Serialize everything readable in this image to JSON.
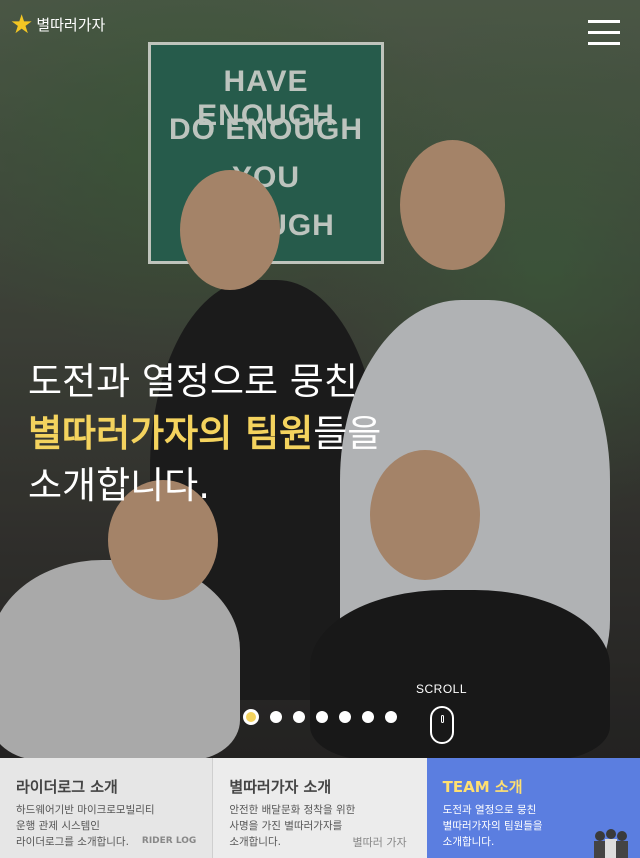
{
  "header": {
    "logo_text": "별따러가자",
    "menu_icon": "hamburger-icon"
  },
  "hero": {
    "sign_lines": [
      "HAVE ENOUGH",
      "DO ENOUGH",
      "YOU",
      "ENOUGH"
    ],
    "headline": {
      "line1": "도전과 열정으로 뭉친",
      "line2_highlight": "별따러가자의 팀원",
      "line2_rest": "들을",
      "line3": "소개합니다."
    },
    "scroll_label": "SCROLL",
    "slider": {
      "count": 7,
      "active_index": 0
    }
  },
  "tabs": [
    {
      "title": "라이더로그 소개",
      "desc": "하드웨어기반 마이크로모빌리티\n운행 관제 시스템인\n라이더로그를 소개합니다.",
      "brand": "RIDER LOG"
    },
    {
      "title": "별따러가자 소개",
      "desc": "안전한 배달문화 정착을 위한\n사명을 가진 별따러가자를\n소개합니다.",
      "brand": "별따러 가자"
    },
    {
      "title": "TEAM 소개",
      "desc": "도전과 열정으로 뭉친\n별따러가자의 팀원들을\n소개합니다.",
      "active": true
    }
  ],
  "colors": {
    "highlight": "#f4d35e",
    "active_tab": "#5b7ee0"
  }
}
